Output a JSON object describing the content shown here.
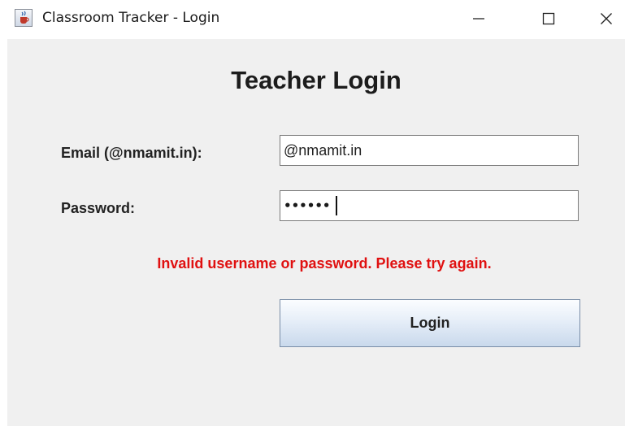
{
  "window": {
    "title": "Classroom Tracker - Login",
    "app_icon": "java-cup-icon",
    "controls": {
      "minimize_icon": "minimize-icon",
      "maximize_icon": "maximize-icon",
      "close_icon": "close-icon"
    }
  },
  "form": {
    "heading": "Teacher Login",
    "email_label": "Email (@nmamit.in):",
    "email_value": "@nmamit.in",
    "password_label": "Password:",
    "password_masked": "••••••",
    "error_message": "Invalid username or password. Please try again.",
    "login_label": "Login"
  },
  "colors": {
    "error": "#e01010",
    "panel_background": "#f0f0f0",
    "button_gradient_top": "#fbfdff",
    "button_gradient_bottom": "#c9d9ec"
  }
}
